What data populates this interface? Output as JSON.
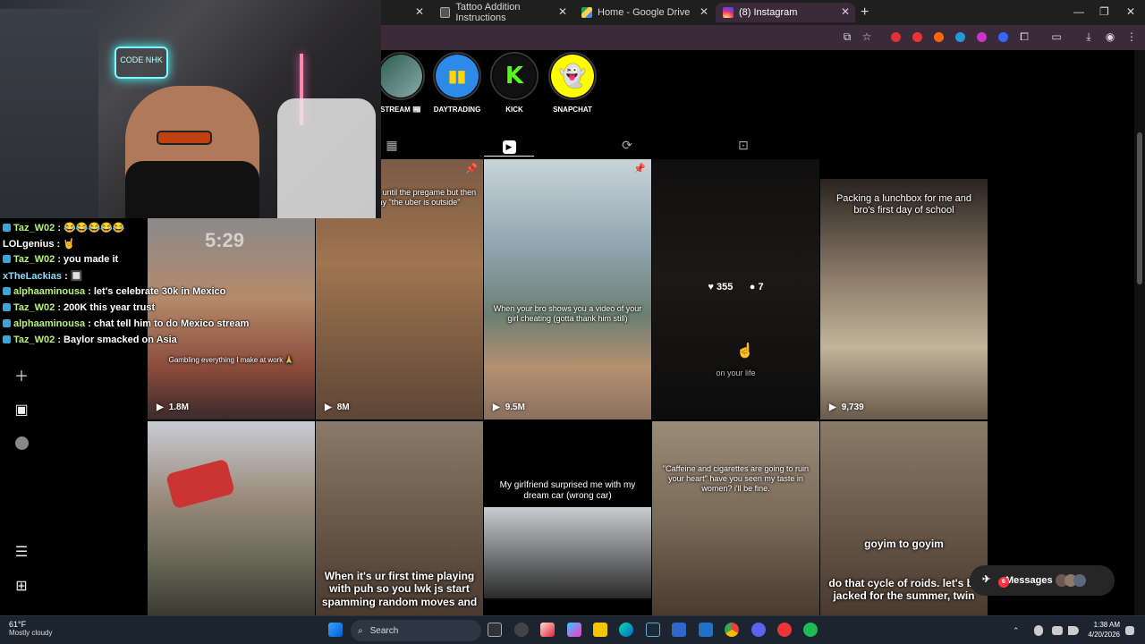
{
  "browser": {
    "tabs": [
      {
        "title": "Tattoo Addition Instructions",
        "active": false
      },
      {
        "title": "Home - Google Drive",
        "active": false
      },
      {
        "title": "(8) Instagram",
        "active": true
      }
    ]
  },
  "webcam": {
    "sign_text": "CODE NHK"
  },
  "chat": [
    {
      "user": "Taz_W02",
      "message": "😂😂😂😂😂"
    },
    {
      "user": "LOLgenius",
      "message": "🤘"
    },
    {
      "user": "Taz_W02",
      "message": "you made it"
    },
    {
      "user": "xTheLackias",
      "message": "🔲"
    },
    {
      "user": "alphaaminousa",
      "message": "let's celebrate 30k in Mexico"
    },
    {
      "user": "Taz_W02",
      "message": "200K this year trust"
    },
    {
      "user": "alphaaminousa",
      "message": "chat tell him to do Mexico stream"
    },
    {
      "user": "Taz_W02",
      "message": "Baylor smacked on Asia"
    }
  ],
  "highlights": [
    {
      "label": "STREAM 📰"
    },
    {
      "label": "DAYTRADING"
    },
    {
      "label": "KICK"
    },
    {
      "label": "SNAPCHAT"
    }
  ],
  "reels": [
    {
      "caption": "you're not drunk until the pregame but then someone say \"the uber is outside\"",
      "views": "8M",
      "pinned": true
    },
    {
      "caption": "When your bro shows you a video of your girl cheating (gotta thank him still)",
      "views": "9.5M",
      "pinned": true
    },
    {
      "caption": "on your life",
      "likes": "355",
      "comments": "7",
      "hover": true
    },
    {
      "caption": "Packing a lunchbox for me and bro's first day of school",
      "views": "9,739"
    },
    {
      "caption": "Gambling everything I make at work 🙏",
      "views": "1.8M",
      "clock_text": "5:29"
    },
    {
      "caption": ""
    },
    {
      "caption": "When it's ur first time playing with puh so you lwk js start spamming random moves and"
    },
    {
      "caption": "My girlfriend surprised me with my dream car (wrong car)"
    },
    {
      "caption": "\"Caffeine and cigarettes are going to ruin your heart\" have you seen my taste in women? i'll be fine."
    },
    {
      "caption_top": "goyim to goyim",
      "caption_bottom": "do that cycle of roids. let's be jacked for the summer, twin"
    }
  ],
  "messages": {
    "label": "Messages",
    "count": "6"
  },
  "taskbar": {
    "temperature": "61°F",
    "weather": "Mostly cloudy",
    "search_placeholder": "Search",
    "time": "1:38 AM",
    "date": "4/20/2026"
  },
  "colors": {
    "accent": "#3a2a3a",
    "taskbar": "#1c2430",
    "chat_user": "#b7f27a",
    "notification": "#ff3040"
  }
}
